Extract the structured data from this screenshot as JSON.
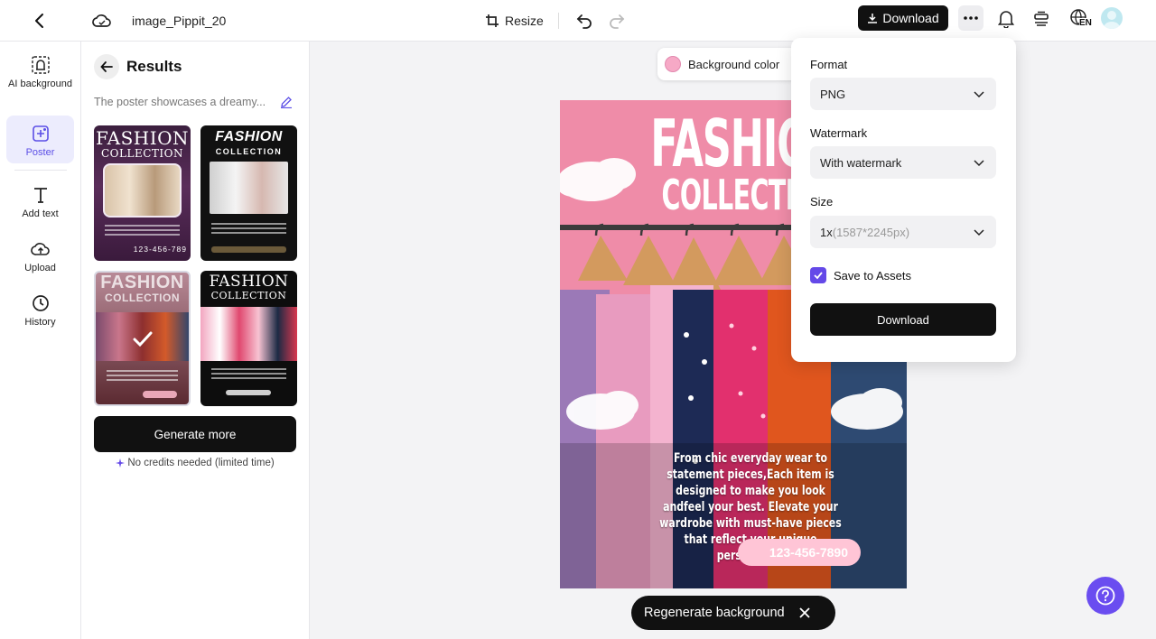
{
  "topbar": {
    "doc_title": "image_Pippit_20",
    "resize_label": "Resize",
    "download_label": "Download",
    "lang_code": "EN"
  },
  "leftnav": {
    "items": [
      {
        "label": "AI background",
        "icon": "ai-background-icon"
      },
      {
        "label": "Poster",
        "icon": "poster-icon"
      },
      {
        "label": "Add text",
        "icon": "text-icon"
      },
      {
        "label": "Upload",
        "icon": "upload-icon"
      },
      {
        "label": "History",
        "icon": "history-icon"
      }
    ],
    "active": "Poster"
  },
  "results": {
    "title": "Results",
    "description": "The poster showcases a dreamy...",
    "thumbnails": [
      {
        "title_top": "FASHION",
        "title_bottom": "COLLECTION",
        "phone": "123-456-789"
      },
      {
        "title_top": "FASHION",
        "title_bottom": "COLLECTION"
      },
      {
        "title_top": "FASHION",
        "title_bottom": "COLLECTION",
        "selected": true
      },
      {
        "title_top": "FASHION",
        "title_bottom": "COLLECTION"
      }
    ],
    "generate_more_label": "Generate more",
    "credits_note": "No credits needed (limited time)"
  },
  "canvas": {
    "background_color_label": "Background color",
    "swatch_color": "#f6a9c6",
    "poster": {
      "title_line1": "FASHION",
      "title_line2": "COLLECTION",
      "body": "From chic everyday wear to statement pieces,Each item is designed to make you look andfeel your best. Elevate your wardrobe with must-have pieces that reflect your unique personality!",
      "phone": "123-456-7890"
    },
    "regenerate_label": "Regenerate background"
  },
  "download_menu": {
    "format_label": "Format",
    "format_value": "PNG",
    "watermark_label": "Watermark",
    "watermark_value": "With watermark",
    "size_label": "Size",
    "size_value": "1x",
    "size_detail": "(1587*2245px)",
    "save_to_assets_label": "Save to Assets",
    "save_to_assets_checked": true,
    "download_label": "Download"
  },
  "colors": {
    "accent": "#6449e8",
    "primary_button": "#111111",
    "help_button": "#6a4df0"
  }
}
